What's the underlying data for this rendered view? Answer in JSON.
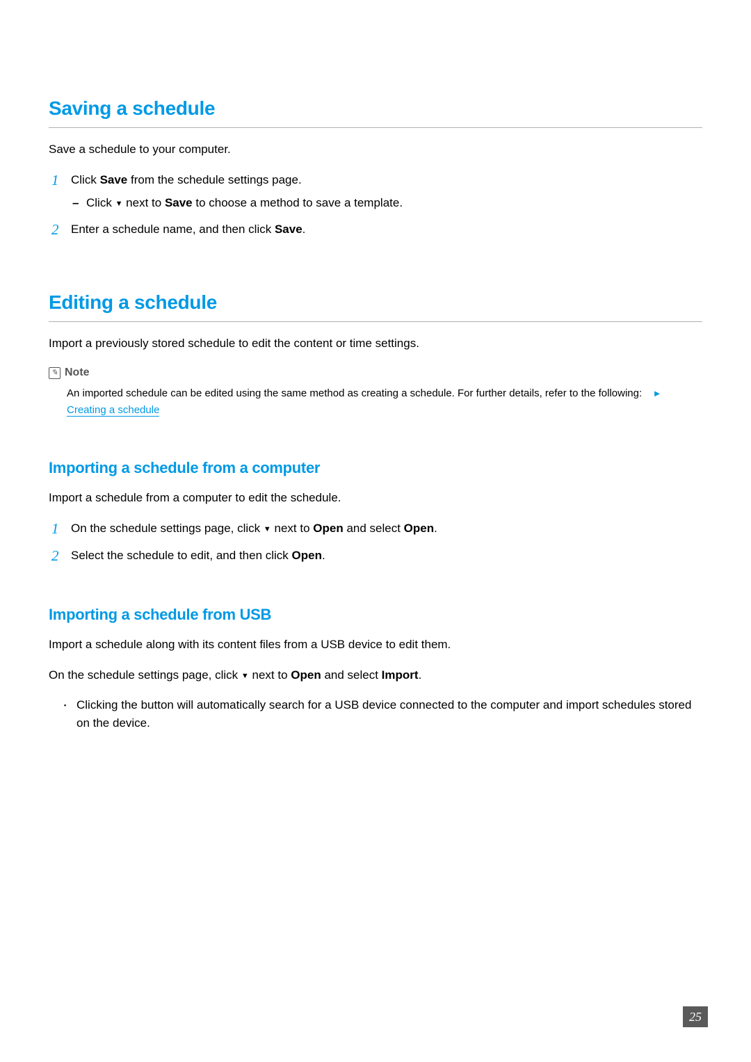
{
  "saving": {
    "heading": "Saving a schedule",
    "intro": "Save a schedule to your computer.",
    "step1_pre": "Click ",
    "step1_bold": "Save",
    "step1_post": " from the schedule settings page.",
    "step1_sub_pre": "Click ",
    "step1_sub_mid": " next to ",
    "step1_sub_bold": "Save",
    "step1_sub_post": " to choose a method to save a template.",
    "step2_pre": "Enter a schedule name, and then click ",
    "step2_bold": "Save",
    "step2_post": "."
  },
  "editing": {
    "heading": "Editing a schedule",
    "intro": "Import a previously stored schedule to edit the content or time settings.",
    "note_label": "Note",
    "note_text": "An imported schedule can be edited using the same method as creating a schedule. For further details, refer to the following:",
    "note_link": "Creating a schedule"
  },
  "import_computer": {
    "heading": "Importing a schedule from a computer",
    "intro": "Import a schedule from a computer to edit the schedule.",
    "step1_pre": "On the schedule settings page, click ",
    "step1_mid": " next to ",
    "step1_b1": "Open",
    "step1_mid2": " and select ",
    "step1_b2": "Open",
    "step1_post": ".",
    "step2_pre": "Select the schedule to edit, and then click ",
    "step2_bold": "Open",
    "step2_post": "."
  },
  "import_usb": {
    "heading": "Importing a schedule from USB",
    "intro": "Import a schedule along with its content files from a USB device to edit them.",
    "line_pre": "On the schedule settings page, click ",
    "line_mid": " next to ",
    "line_b1": "Open",
    "line_mid2": " and select ",
    "line_b2": "Import",
    "line_post": ".",
    "bullet": "Clicking the button will automatically search for a USB device connected to the computer and import schedules stored on the device."
  },
  "nums": {
    "n1": "1",
    "n2": "2"
  },
  "page": "25",
  "glyphs": {
    "dash": "–",
    "square": "▪",
    "tri_down": "▼",
    "tri_right": "►"
  }
}
